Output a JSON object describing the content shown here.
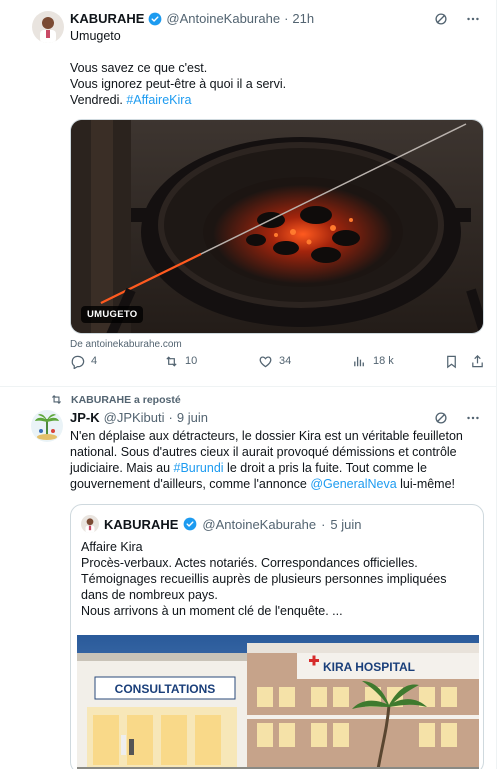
{
  "tweet1": {
    "display_name": "KABURAHE",
    "handle": "@AntoineKaburahe",
    "separator": "·",
    "time": "21h",
    "lines": [
      "Umugeto",
      "",
      "Vous savez ce que c'est.",
      "Vous ignorez peut-être à quoi il a servi.",
      "Vendredi."
    ],
    "hashtag": "#AffaireKira",
    "media_label": "UMUGETO",
    "source": "De antoinekaburahe.com",
    "actions": {
      "replies": "4",
      "reposts": "10",
      "likes": "34",
      "views": "18 k"
    }
  },
  "tweet2": {
    "repost_label": "KABURAHE a reposté",
    "display_name": "JP-K",
    "handle": "@JPKibuti",
    "separator": "·",
    "time": "9 juin",
    "text_parts": {
      "p1": "N'en déplaise aux détracteurs, le dossier Kira est un véritable feuilleton national. Sous d'autres cieux il aurait provoqué démissions et contrôle judiciaire. Mais au ",
      "tag": "#Burundi",
      "p2": " le droit a pris la fuite. Tout comme le gouvernement d'ailleurs, comme l'annonce ",
      "mention": "@GeneralNeva",
      "p3": " lui-même!"
    },
    "quote": {
      "display_name": "KABURAHE",
      "handle": "@AntoineKaburahe",
      "separator": "·",
      "time": "5 juin",
      "lines": [
        "Affaire Kira",
        "Procès-verbaux. Actes notariés. Correspondances officielles.",
        "Témoignages recueillis auprès de plusieurs personnes impliquées  dans de nombreux pays.",
        "Nous arrivons à un moment clé de l'enquête. ..."
      ],
      "sign_consultations": "CONSULTATIONS",
      "sign_hospital": "KIRA HOSPITAL"
    }
  },
  "colors": {
    "accent": "#1d9bf0",
    "muted": "#536471",
    "border": "#eff3f4"
  },
  "icons": [
    "verified-badge-icon",
    "grok-icon",
    "more-icon",
    "reply-icon",
    "repost-icon",
    "like-icon",
    "views-icon",
    "bookmark-icon",
    "share-icon"
  ]
}
